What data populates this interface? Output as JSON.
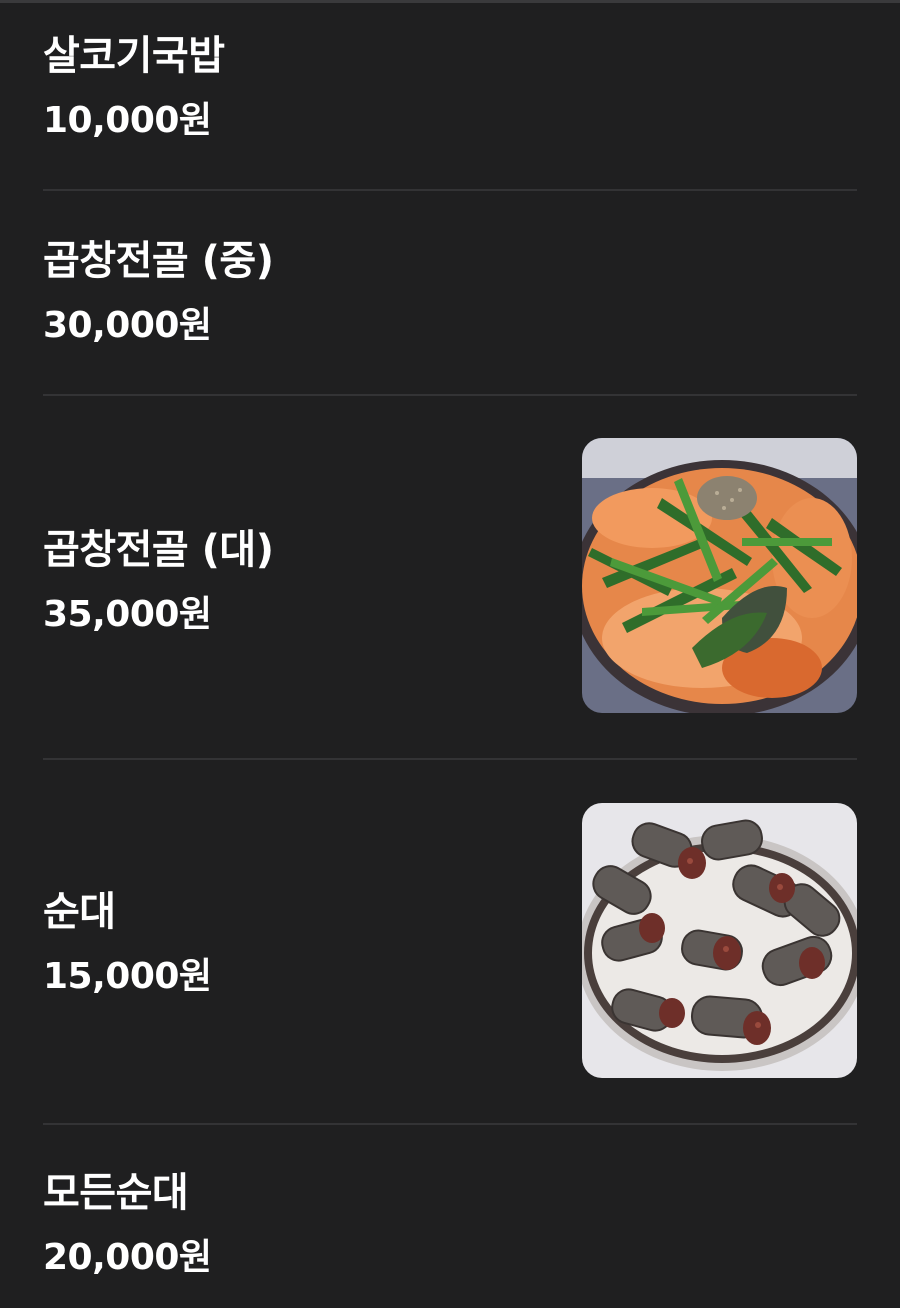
{
  "menu": {
    "items": [
      {
        "name": "살코기국밥",
        "price": "10,000원"
      },
      {
        "name": "곱창전골 (중)",
        "price": "30,000원"
      },
      {
        "name": "곱창전골 (대)",
        "price": "35,000원",
        "photo": "tripe-hotpot-photo"
      },
      {
        "name": "순대",
        "price": "15,000원",
        "photo": "sundae-photo"
      },
      {
        "name": "모든순대",
        "price": "20,000원"
      }
    ]
  },
  "colors": {
    "background": "#1f1f20",
    "text": "#ffffff",
    "divider": "#333335"
  }
}
